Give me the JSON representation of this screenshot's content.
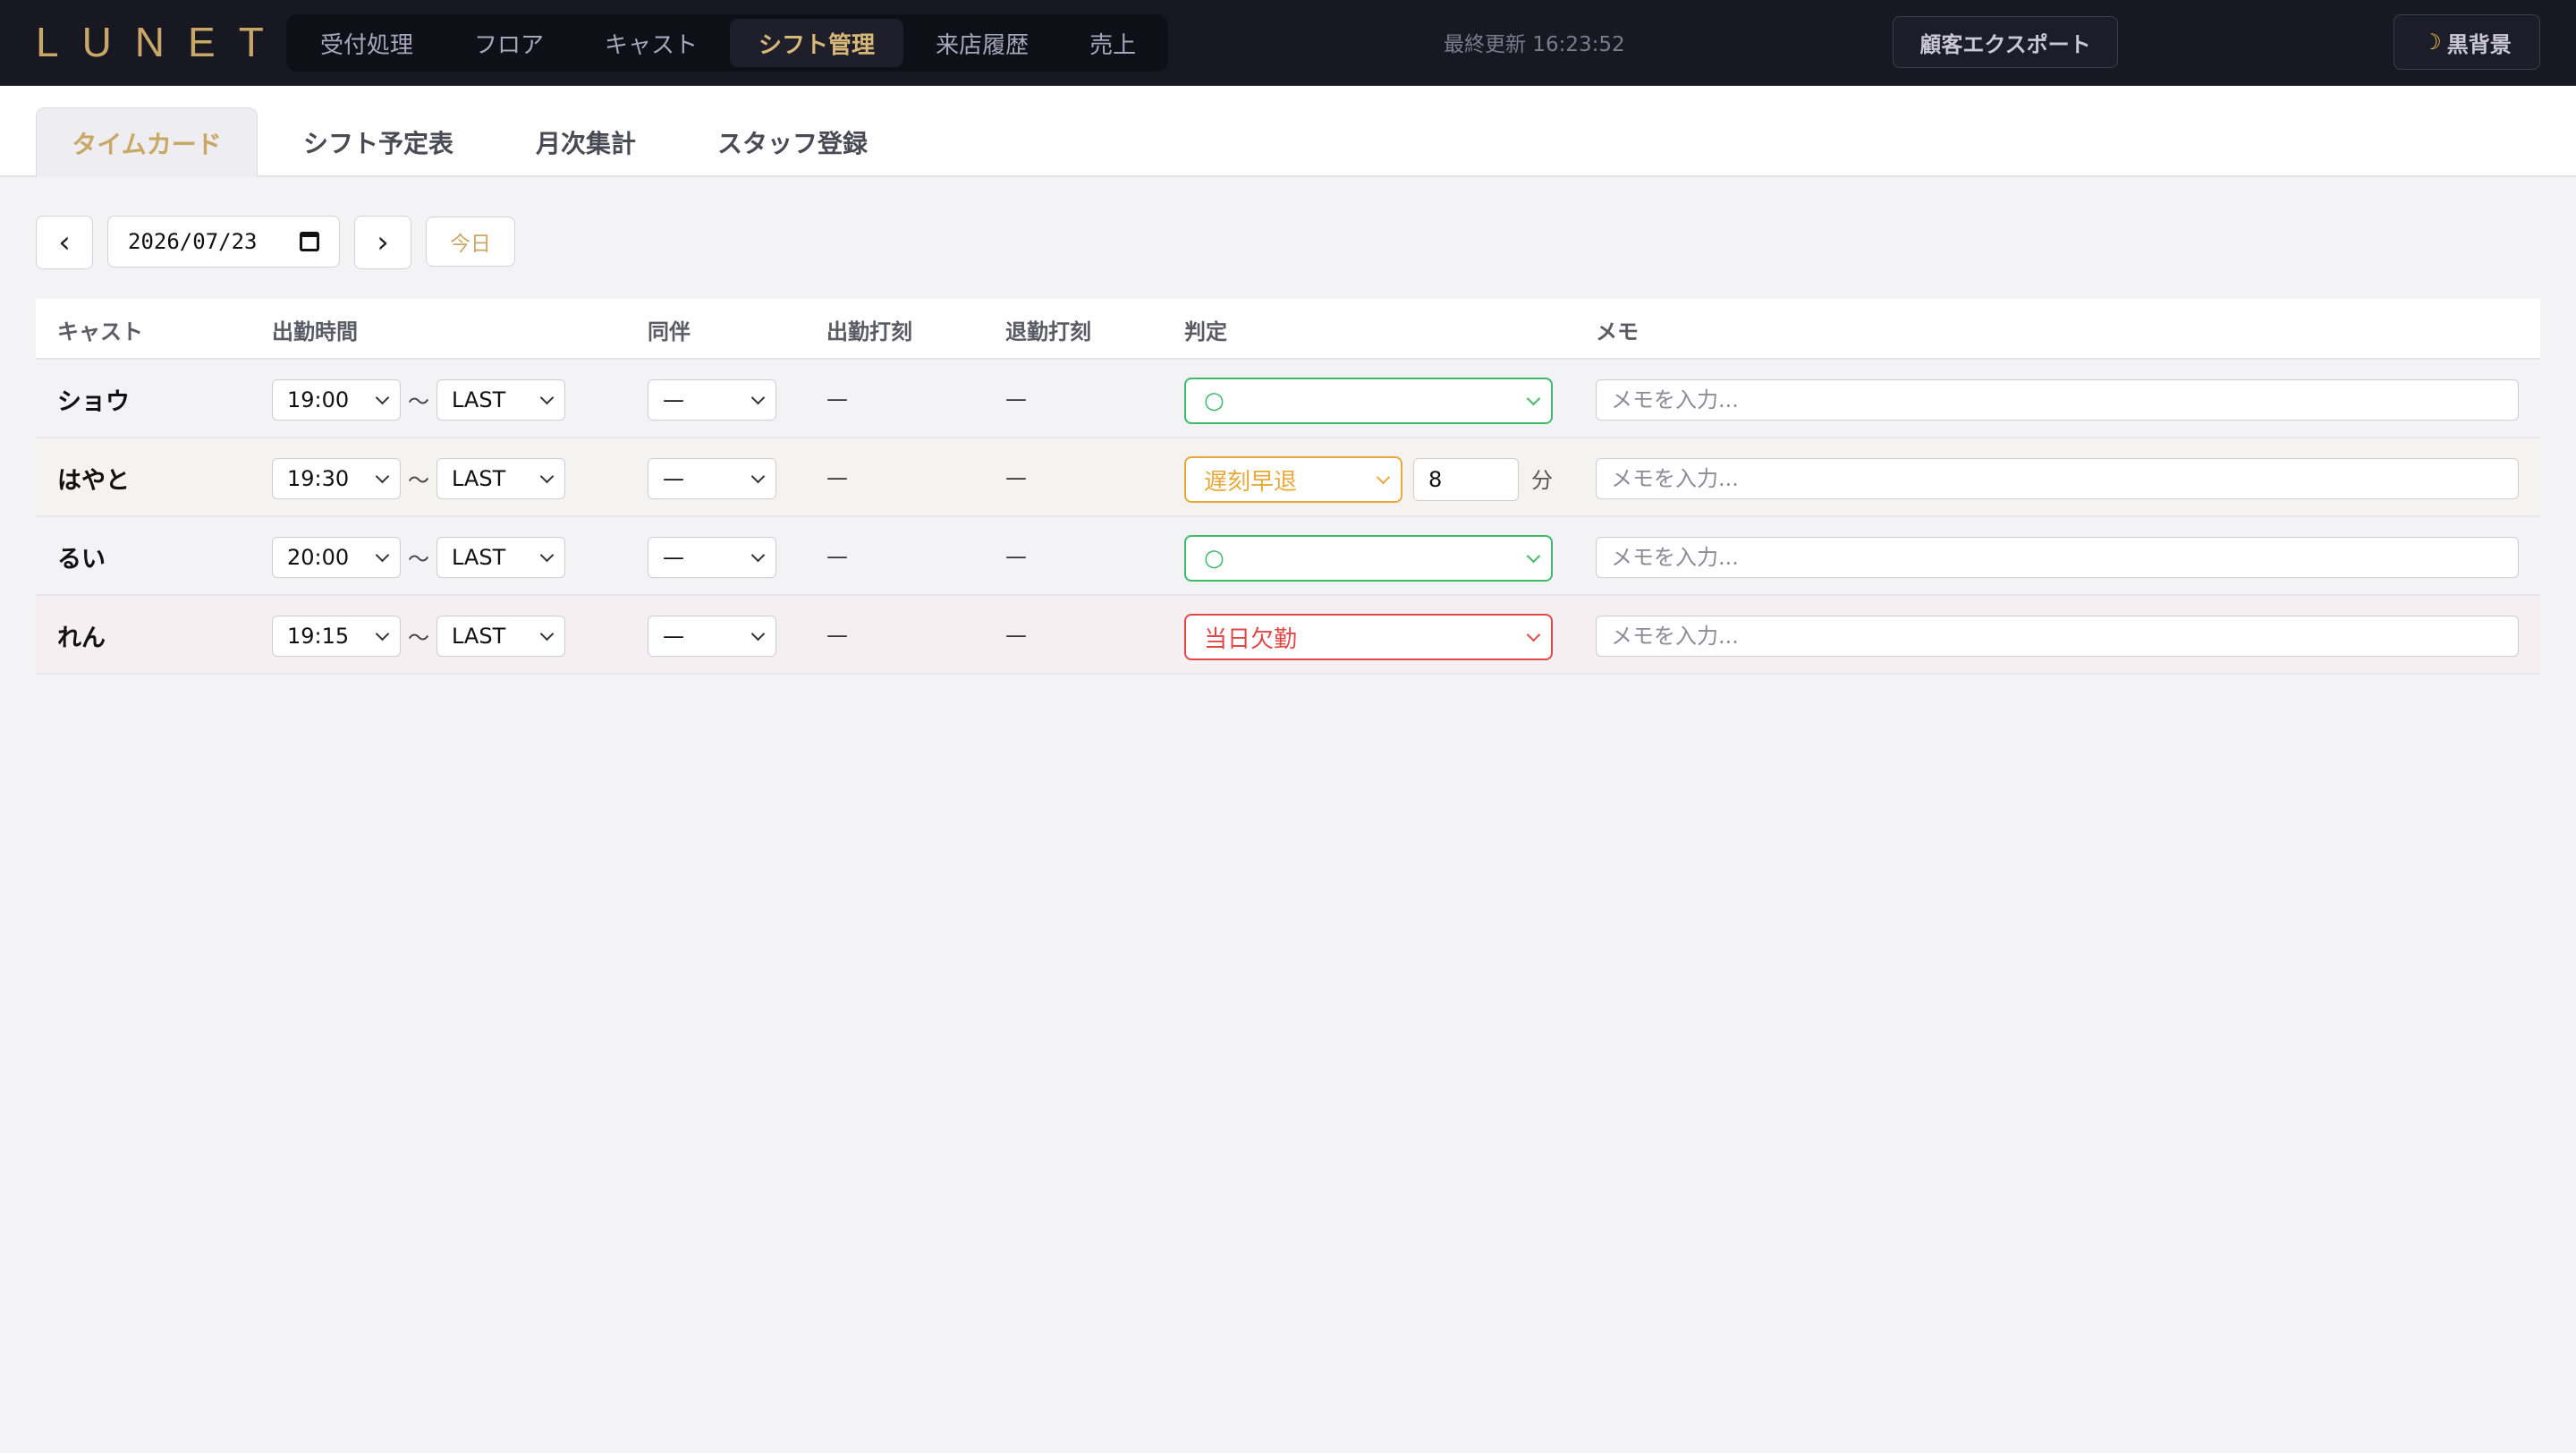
{
  "app": {
    "logo": "LUNET",
    "nav": [
      "受付処理",
      "フロア",
      "キャスト",
      "シフト管理",
      "来店履歴",
      "売上"
    ],
    "nav_active": 3,
    "last_updated": "最終更新 16:23:52",
    "export_label": "顧客エクスポート",
    "theme_label": "黒背景",
    "theme_icon": "moon-icon"
  },
  "subtabs": {
    "items": [
      "タイムカード",
      "シフト予定表",
      "月次集計",
      "スタッフ登録"
    ],
    "active": 0
  },
  "date_controls": {
    "prev": "‹",
    "next": "›",
    "date": "2026/07/23",
    "today": "今日"
  },
  "table": {
    "headers": [
      "キャスト",
      "出勤時間",
      "同伴",
      "出勤打刻",
      "退勤打刻",
      "判定",
      "メモ"
    ],
    "tilde": "〜",
    "memo_placeholder": "メモを入力...",
    "rows": [
      {
        "name": "ショウ",
        "start": "19:00",
        "end": "LAST",
        "douhan": "—",
        "clock_in": "—",
        "clock_out": "—",
        "judge": "○",
        "judge_status": "ok",
        "minutes": "",
        "unit": "",
        "memo": ""
      },
      {
        "name": "はやと",
        "start": "19:30",
        "end": "LAST",
        "douhan": "—",
        "clock_in": "—",
        "clock_out": "—",
        "judge": "遅刻早退",
        "judge_status": "late",
        "minutes": "8",
        "unit": "分",
        "memo": ""
      },
      {
        "name": "るい",
        "start": "20:00",
        "end": "LAST",
        "douhan": "—",
        "clock_in": "—",
        "clock_out": "—",
        "judge": "○",
        "judge_status": "ok",
        "minutes": "",
        "unit": "",
        "memo": ""
      },
      {
        "name": "れん",
        "start": "19:15",
        "end": "LAST",
        "douhan": "—",
        "clock_in": "—",
        "clock_out": "—",
        "judge": "当日欠勤",
        "judge_status": "absent",
        "minutes": "",
        "unit": "",
        "memo": ""
      }
    ]
  },
  "colors": {
    "accent": "#c9a766",
    "ok": "#3cba68",
    "late": "#e8a93a",
    "absent": "#e04848",
    "topbar": "#181823"
  }
}
